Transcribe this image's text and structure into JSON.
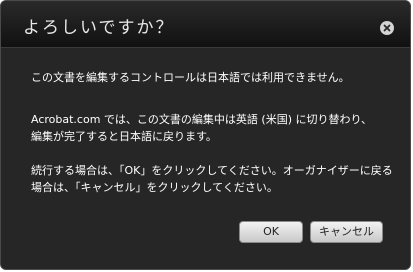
{
  "dialog": {
    "title": "よろしいですか？",
    "close_icon": "close-icon",
    "messages": {
      "line1": "この文書を編集するコントロールは日本語では利用できません。",
      "line2": "Acrobat.com では、この文書の編集中は英語 (米国) に切り替わり、",
      "line2b": "編集が完了すると日本語に戻ります。",
      "line3": "続行する場合は、「OK」をクリックしてください。オーガナイザーに戻る",
      "line3b": "場合は、「キャンセル」をクリックしてください。"
    },
    "buttons": {
      "ok_label": "OK",
      "cancel_label": "キャンセル"
    }
  }
}
